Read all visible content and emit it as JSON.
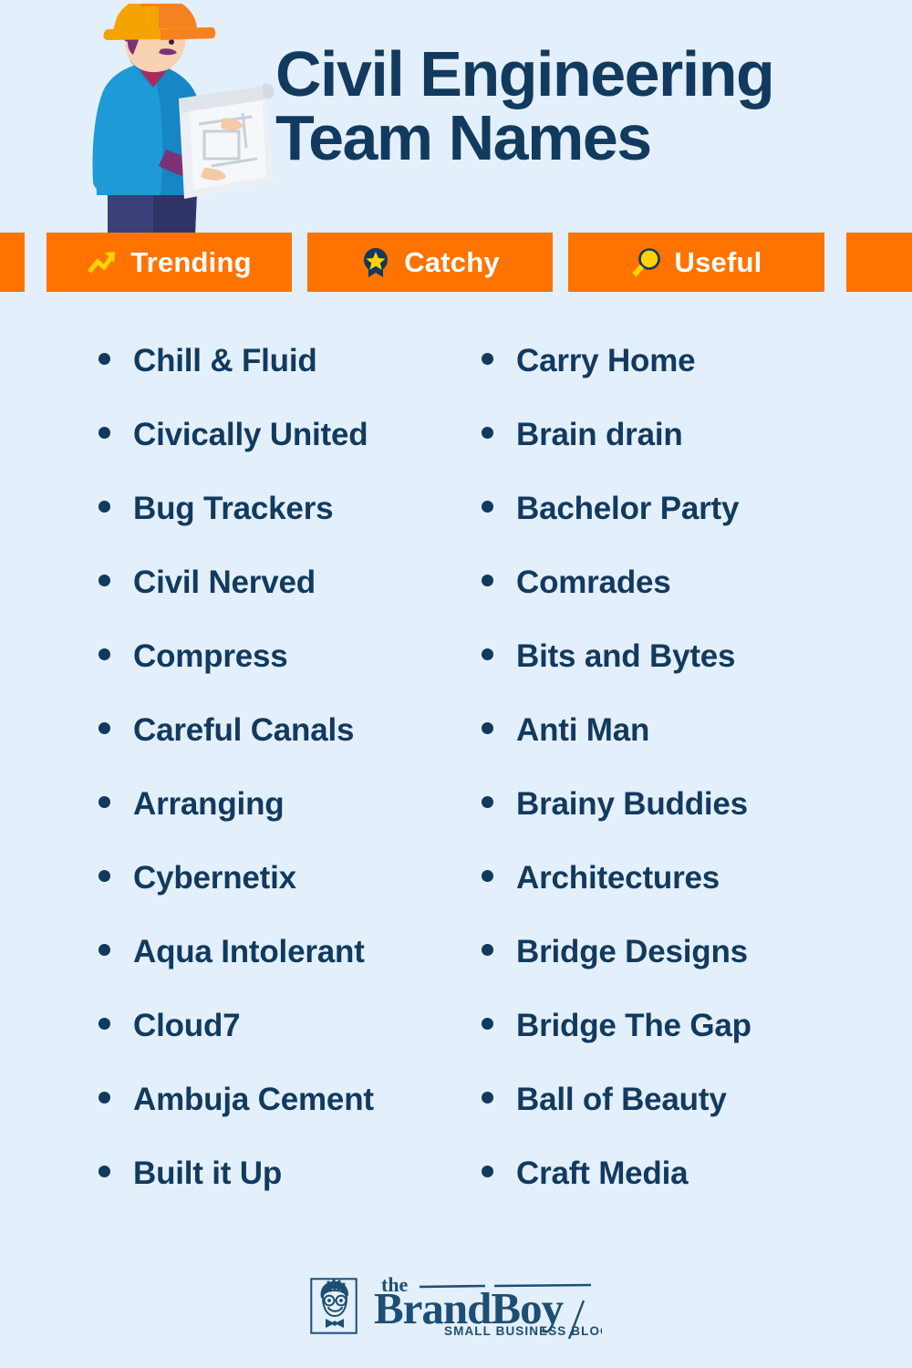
{
  "page": {
    "background_color": "#e3effb",
    "accent_color": "#ff7300",
    "text_color": "#123a5e",
    "icon_highlight_color": "#ffd400"
  },
  "header": {
    "title_line1": "Civil Engineering",
    "title_line2": "Team Names",
    "illustration_name": "civil-engineer-with-blueprint"
  },
  "badges": [
    {
      "label": "Trending",
      "icon": "trending-up-icon"
    },
    {
      "label": "Catchy",
      "icon": "award-star-icon"
    },
    {
      "label": "Useful",
      "icon": "magnifier-icon"
    }
  ],
  "lists": {
    "left_column": [
      "Chill & Fluid",
      "Civically United",
      "Bug Trackers",
      "Civil Nerved",
      "Compress",
      "Careful Canals",
      "Arranging",
      "Cybernetix",
      "Aqua Intolerant",
      "Cloud7",
      "Ambuja Cement",
      "Built it Up"
    ],
    "right_column": [
      "Carry Home",
      "Brain drain",
      "Bachelor Party",
      "Comrades",
      "Bits and Bytes",
      "Anti Man",
      "Brainy Buddies",
      "Architectures",
      "Bridge Designs",
      "Bridge The Gap",
      "Ball of Beauty",
      "Craft Media"
    ]
  },
  "footer": {
    "logo_the": "the",
    "logo_brand": "BrandBoy",
    "logo_tagline": "SMALL BUSINESS BLOG",
    "logo_mark_name": "boy-with-glasses-icon"
  }
}
